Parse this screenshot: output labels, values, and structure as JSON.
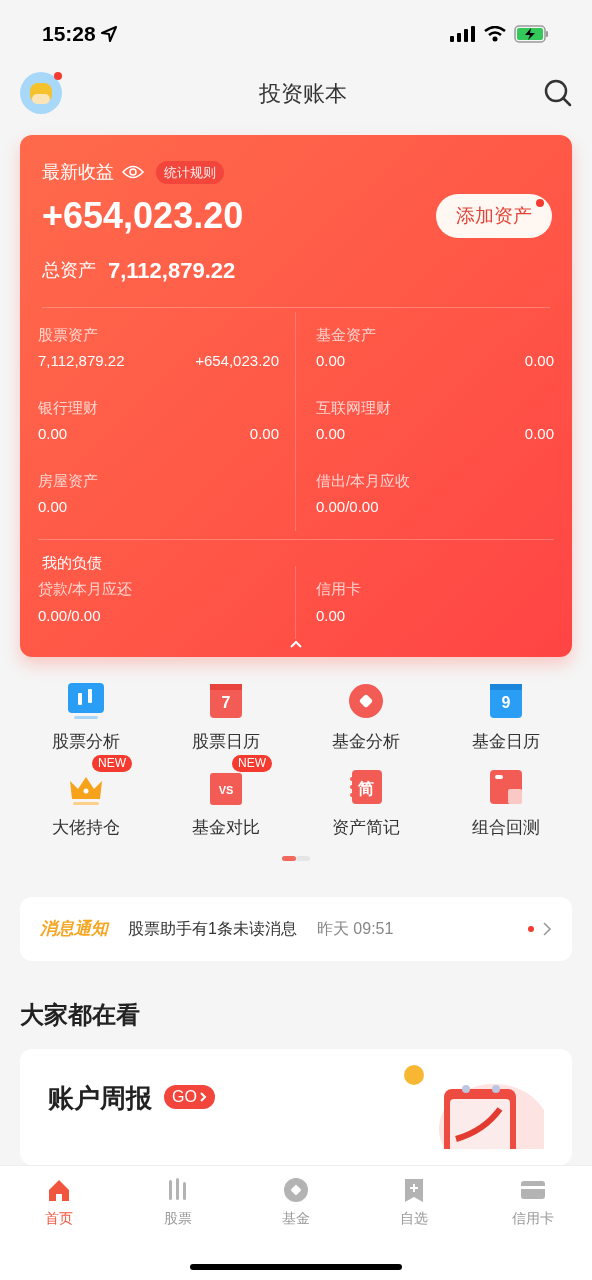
{
  "status_bar": {
    "time": "15:28"
  },
  "header": {
    "title": "投资账本",
    "avatar_dot": true
  },
  "summary": {
    "label": "最新收益",
    "rules": "统计规则",
    "profit": "+654,023.20",
    "total_label": "总资产",
    "total": "7,112,879.22",
    "add_button": "添加资产",
    "add_dot": true
  },
  "assets": [
    {
      "label": "股票资产",
      "value": "7,112,879.22",
      "change": "+654,023.20"
    },
    {
      "label": "基金资产",
      "value": "0.00",
      "change": "0.00"
    },
    {
      "label": "银行理财",
      "value": "0.00",
      "change": "0.00"
    },
    {
      "label": "互联网理财",
      "value": "0.00",
      "change": "0.00"
    },
    {
      "label": "房屋资产",
      "value": "0.00"
    },
    {
      "label": "借出/本月应收",
      "value": "0.00/0.00"
    }
  ],
  "debts": {
    "title": "我的负债",
    "items": [
      {
        "label": "贷款/本月应还",
        "value": "0.00/0.00"
      },
      {
        "label": "信用卡",
        "value": "0.00"
      }
    ]
  },
  "tools": [
    {
      "label": "股票分析"
    },
    {
      "label": "股票日历",
      "glyph": "7"
    },
    {
      "label": "基金分析"
    },
    {
      "label": "基金日历",
      "glyph": "9"
    },
    {
      "label": "大佬持仓",
      "badge": "NEW"
    },
    {
      "label": "基金对比",
      "badge": "NEW",
      "glyph": "VS"
    },
    {
      "label": "资产简记",
      "glyph": "简"
    },
    {
      "label": "组合回测"
    }
  ],
  "pages": [
    {
      "selected": true
    },
    {
      "selected": false
    }
  ],
  "notice": {
    "label": "消息通知",
    "text": "股票助手有1条未读消息",
    "time": "昨天 09:51",
    "unread": true
  },
  "section_title": "大家都在看",
  "promo": {
    "title": "账户周报",
    "go": "GO"
  },
  "tabs": [
    {
      "label": "首页",
      "selected": true
    },
    {
      "label": "股票",
      "selected": false
    },
    {
      "label": "基金",
      "selected": false
    },
    {
      "label": "自选",
      "selected": false
    },
    {
      "label": "信用卡",
      "selected": false
    }
  ]
}
